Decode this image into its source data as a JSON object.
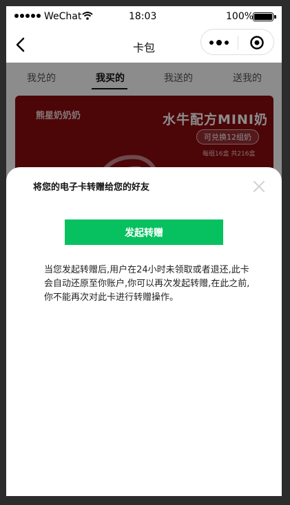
{
  "status_bar": {
    "carrier": "WeChat",
    "time": "18:03",
    "battery_percent": "100%",
    "wifi_icon": "wifi-icon",
    "signal_icon": "signal-dots-icon",
    "battery_icon": "battery-icon"
  },
  "navbar": {
    "title": "卡包",
    "back_icon": "chevron-left-icon",
    "more_icon": "more-dots-icon",
    "close_icon": "target-circle-icon"
  },
  "tabs": [
    {
      "label": "我兑的",
      "active": false
    },
    {
      "label": "我买的",
      "active": true
    },
    {
      "label": "我送的",
      "active": false
    },
    {
      "label": "送我的",
      "active": false
    }
  ],
  "card": {
    "brand": "熊星奶奶奶",
    "title": "水牛配方MINI奶",
    "pill": "可兑换12组奶",
    "sub": "每组16盒 共216盒",
    "background": "#8a0b10"
  },
  "sheet": {
    "title": "将您的电子卡转赠给您的好友",
    "close_icon": "close-icon",
    "button_label": "发起转赠",
    "button_color": "#07c160",
    "description": "当您发起转赠后,用户在24小时未领取或者退还,此卡会自动还原至你账户,你可以再次发起转赠,在此之前,你不能再次对此卡进行转赠操作。"
  }
}
